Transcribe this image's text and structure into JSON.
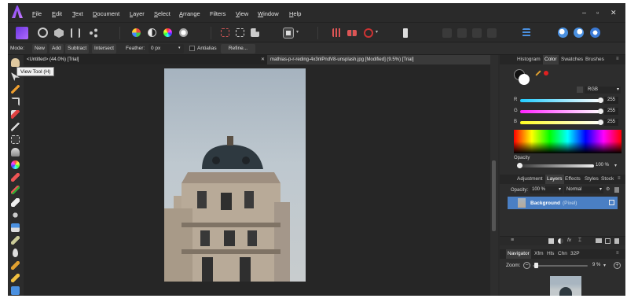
{
  "menu": {
    "items": [
      {
        "pre": "",
        "u": "F",
        "post": "ile"
      },
      {
        "pre": "",
        "u": "E",
        "post": "dit"
      },
      {
        "pre": "",
        "u": "T",
        "post": "ext"
      },
      {
        "pre": "",
        "u": "D",
        "post": "ocument"
      },
      {
        "pre": "",
        "u": "L",
        "post": "ayer"
      },
      {
        "pre": "",
        "u": "S",
        "post": "elect"
      },
      {
        "pre": "",
        "u": "A",
        "post": "rrange"
      },
      {
        "pre": "Filters",
        "u": "",
        "post": ""
      },
      {
        "pre": "",
        "u": "V",
        "post": "iew"
      },
      {
        "pre": "",
        "u": "W",
        "post": "indow"
      },
      {
        "pre": "",
        "u": "H",
        "post": "elp"
      }
    ],
    "win_minimize": "–",
    "win_restore": "▫",
    "win_close": "✕"
  },
  "context": {
    "mode_label": "Mode:",
    "new": "New",
    "add": "Add",
    "subtract": "Subtract",
    "intersect": "Intersect",
    "feather_label": "Feather:",
    "feather_value": "0 px",
    "antialias": "Antialias",
    "refine": "Refine..."
  },
  "tabs": {
    "doc1": "<Untitled> (44.0%) [Trial]",
    "doc2": "mathias-p-r-reding-4x3nlPndV8-unsplash.jpg [Modified] (9.5%) [Trial]",
    "close": "✕"
  },
  "tooltip": "View Tool (H)",
  "panel_top": {
    "tabs": [
      "Histogram",
      "Color",
      "Swatches",
      "Brushes"
    ],
    "active": "Color",
    "color_model": "RGB",
    "r_label": "R",
    "g_label": "G",
    "b_label": "B",
    "r_value": "255",
    "g_value": "255",
    "b_value": "255",
    "opacity_label": "Opacity",
    "opacity_value": "100 %"
  },
  "panel_mid": {
    "tabs": [
      "Adjustment",
      "Layers",
      "Effects",
      "Styles",
      "Stock"
    ],
    "active": "Layers",
    "opacity_label": "Opacity:",
    "opacity_value": "100 %",
    "blend": "Normal",
    "layer_name": "Background",
    "layer_type": "(Pixel)"
  },
  "panel_bottom": {
    "tabs": [
      "Navigator",
      "Xfm",
      "Hls",
      "Chn",
      "32P"
    ],
    "active": "Navigator",
    "zoom_label": "Zoom:",
    "zoom_value": "9 %"
  },
  "colors": {
    "bg": "#2a2a2a",
    "accent": "#3f6fb5",
    "brand": "#9a5cff"
  }
}
